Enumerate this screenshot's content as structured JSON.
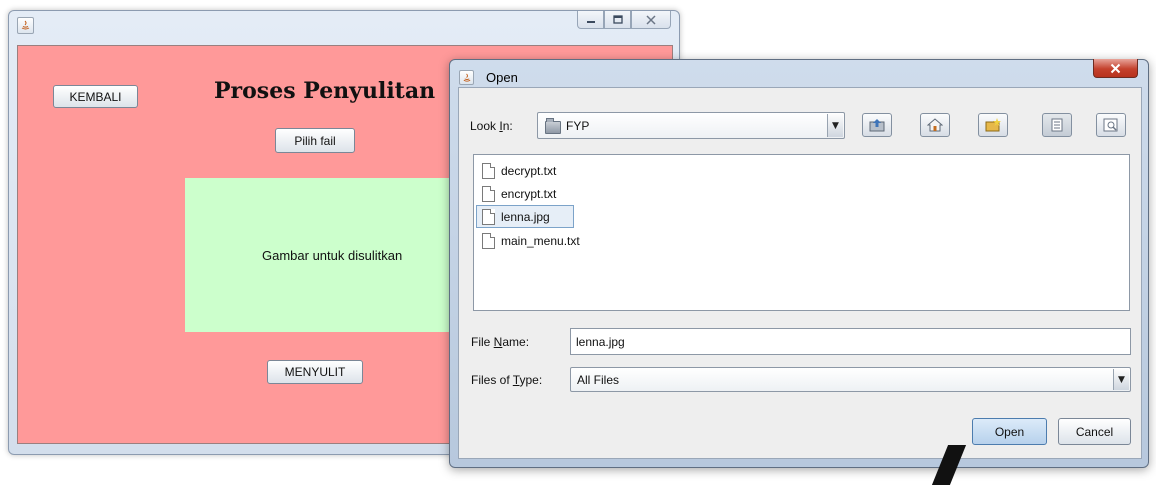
{
  "main_window": {
    "title": "",
    "caption_buttons": {
      "minimize_icon": "minimize-icon",
      "maximize_icon": "maximize-icon",
      "close_icon": "close-icon"
    },
    "back_button": "KEMBALI",
    "heading": "Proses Penyulitan",
    "choose_file_button": "Pilih fail",
    "image_panel_label": "Gambar untuk disulitkan",
    "encrypt_button": "MENYULIT",
    "colors": {
      "content_bg": "#ff9999",
      "image_panel_bg": "#ccffcc"
    }
  },
  "open_dialog": {
    "title": "Open",
    "close_icon": "close-icon",
    "look_in": {
      "label_prefix": "Look ",
      "label_mnemonic": "I",
      "label_suffix": "n:",
      "value": "FYP"
    },
    "toolbar": [
      "up-one-level-icon",
      "home-icon",
      "new-folder-icon",
      "list-view-icon",
      "details-view-icon"
    ],
    "files": [
      {
        "name": "decrypt.txt",
        "selected": false
      },
      {
        "name": "encrypt.txt",
        "selected": false
      },
      {
        "name": "lenna.jpg",
        "selected": true
      },
      {
        "name": "main_menu.txt",
        "selected": false
      }
    ],
    "file_name": {
      "label_prefix": "File ",
      "label_mnemonic": "N",
      "label_suffix": "ame:",
      "value": "lenna.jpg"
    },
    "files_of_type": {
      "label_prefix": "Files of ",
      "label_mnemonic": "T",
      "label_suffix": "ype:",
      "value": "All Files"
    },
    "open_button": "Open",
    "cancel_button": "Cancel"
  }
}
